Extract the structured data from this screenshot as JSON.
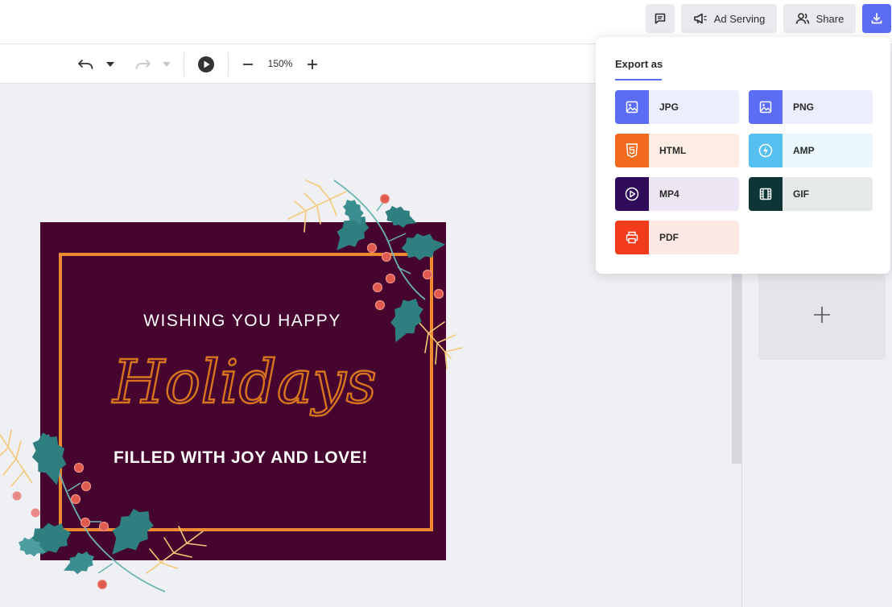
{
  "topbar": {
    "comment_icon": "comment-icon",
    "ad_serving_label": "Ad Serving",
    "share_label": "Share",
    "download_icon": "download-icon"
  },
  "toolbar": {
    "zoom_level": "150%",
    "icons": [
      "undo-icon",
      "chevron-down-icon",
      "redo-icon",
      "chevron-down-icon",
      "play-icon",
      "minus-icon",
      "plus-icon"
    ]
  },
  "canvas": {
    "card": {
      "line1": "WISHING YOU HAPPY",
      "script": "Holidays",
      "line2": "FILLED WITH JOY AND LOVE!",
      "colors": {
        "background": "#45052e",
        "frame": "#f08a30",
        "script": "#d8741f",
        "leaf": "#2f7f80",
        "berry": "#e05a4f",
        "twig": "#f5c97a"
      }
    }
  },
  "export_menu": {
    "title": "Export as",
    "items": [
      {
        "label": "JPG",
        "icon": "image-icon",
        "color": "#5b6cf5",
        "bg": "#eceefe"
      },
      {
        "label": "PNG",
        "icon": "image-icon",
        "color": "#5b6cf5",
        "bg": "#eceefe"
      },
      {
        "label": "HTML",
        "icon": "html5-icon",
        "color": "#f26a1d",
        "bg": "#fdede3"
      },
      {
        "label": "AMP",
        "icon": "amp-icon",
        "color": "#56c0f0",
        "bg": "#eaf7fd"
      },
      {
        "label": "MP4",
        "icon": "play-circle-icon",
        "color": "#2f0b5a",
        "bg": "#ebe6f1"
      },
      {
        "label": "GIF",
        "icon": "film-icon",
        "color": "#0e3535",
        "bg": "#e5e9e9"
      },
      {
        "label": "PDF",
        "icon": "printer-icon",
        "color": "#f23c1c",
        "bg": "#fde8e3"
      }
    ]
  },
  "right_panel": {
    "add_icon": "plus-icon"
  }
}
